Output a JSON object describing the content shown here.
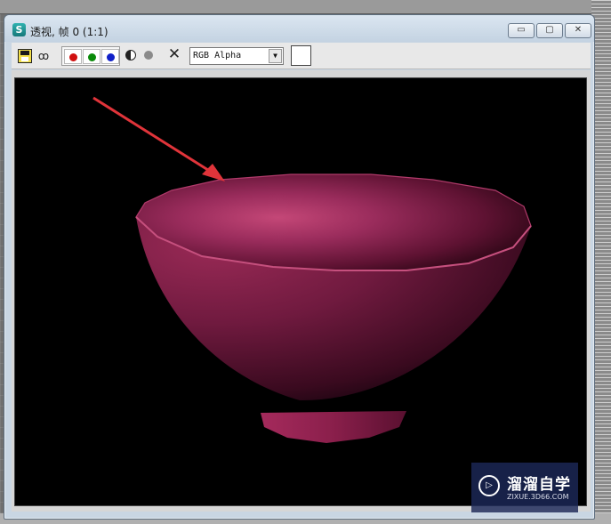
{
  "window": {
    "title": "透视, 帧 0 (1:1)",
    "app_icon": "3ds-max-icon",
    "controls": {
      "minimize": "▭",
      "maximize": "▢",
      "close": "✕"
    }
  },
  "toolbar": {
    "save_icon": "save-icon",
    "clone_icon": "clone-icon",
    "clone_glyph": "ꝏ",
    "channels": [
      {
        "name": "red",
        "color": "#d01010"
      },
      {
        "name": "green",
        "color": "#0a8a0a"
      },
      {
        "name": "blue",
        "color": "#1020c8"
      }
    ],
    "monochrome_icon": "half-circle-icon",
    "alpha_icon": "gray-dot-icon",
    "clear_glyph": "✕",
    "channel_display": {
      "selected": "RGB Alpha",
      "arrow": "▼"
    },
    "swatch_color": "#ffffff"
  },
  "render": {
    "background_color": "#000000",
    "object": "bowl",
    "bowl_colors": {
      "highlight": "#c44777",
      "mid": "#7a1a42",
      "dark": "#3a0a1f"
    },
    "annotation_arrow_color": "#e0343a"
  },
  "watermark": {
    "name": "溜溜自学",
    "url": "ZIXUE.3D66.COM",
    "logo_glyph": "▷"
  }
}
